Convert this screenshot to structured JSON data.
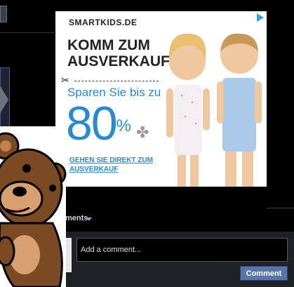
{
  "ad": {
    "brand": "SMARTKIDS.DE",
    "headline": "KOMM ZUM AUSVERKAUF",
    "sub": "Sparen Sie bis zu",
    "percent": "80",
    "percent_sign": "%",
    "cta": "GEHEN SIE DIREKT ZUM AUSVERKAUF",
    "accent_color": "#2a8ad0"
  },
  "comments": {
    "toggle_label": "ments",
    "input_placeholder": "Add a comment...",
    "submit_label": "Comment"
  },
  "icons": {
    "scissors": "scissors-icon",
    "clover": "clover-icon",
    "ad_choices": "ad-choices-icon",
    "caret": "chevron-down-icon",
    "bear": "bear-mascot"
  }
}
